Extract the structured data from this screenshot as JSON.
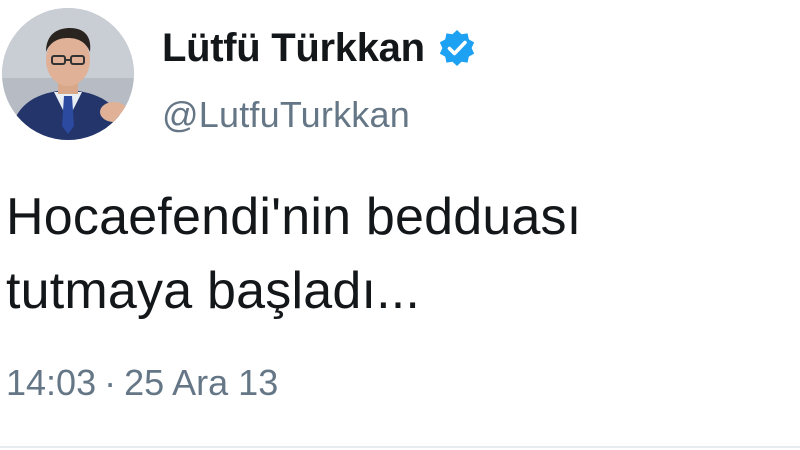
{
  "author": {
    "display_name": "Lütfü Türkkan",
    "handle": "@LutfuTurkkan",
    "verified": true,
    "avatar_icon": "profile-photo"
  },
  "tweet": {
    "text_line_1": "Hocaefendi'nin bedduası",
    "text_line_2": "tutmaya başladı...",
    "time": "14:03",
    "separator": "·",
    "date": "25 Ara 13"
  },
  "colors": {
    "verified_badge": "#1da1f2",
    "secondary_text": "#657786",
    "primary_text": "#14171a"
  }
}
